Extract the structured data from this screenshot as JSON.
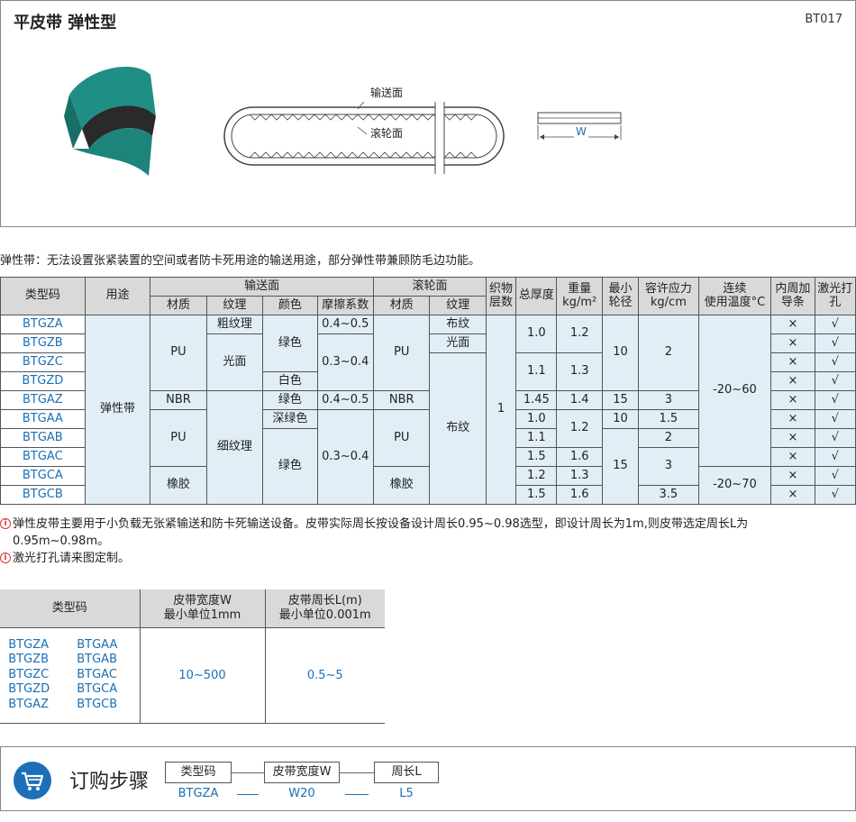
{
  "header": {
    "title": "平皮带   弹性型",
    "code": "BT017"
  },
  "diagram": {
    "label_conveying": "输送面",
    "label_roller": "滚轮面",
    "label_width": "W"
  },
  "description": "弹性带：无法设置张紧装置的空间或者防卡死用途的输送用途，部分弹性带兼顾防毛边功能。",
  "spec_table": {
    "headers": {
      "type_code": "类型码",
      "usage": "用途",
      "conveying": "输送面",
      "roller": "滚轮面",
      "layers": "织物层数",
      "thickness": "总厚度",
      "weight": "重量",
      "weight_unit": "kg/m²",
      "min_pulley": "最小轮径",
      "stress": "容许应力",
      "stress_unit": "kg/cm",
      "temp": "连续",
      "temp2": "使用温度°C",
      "guide": "内周加导条",
      "laser": "激光打孔",
      "sub": {
        "material": "材质",
        "texture": "纹理",
        "color": "颜色",
        "friction": "摩擦系数",
        "material2": "材质",
        "texture2": "纹理"
      }
    },
    "usage": "弹性带",
    "layers": "1",
    "codes": [
      "BTGZA",
      "BTGZB",
      "BTGZC",
      "BTGZD",
      "BTGAZ",
      "BTGAA",
      "BTGAB",
      "BTGAC",
      "BTGCA",
      "BTGCB"
    ],
    "cells": {
      "mat_pu1": "PU",
      "mat_nbr": "NBR",
      "mat_pu2": "PU",
      "mat_rubber": "橡胶",
      "tex_coarse": "粗纹理",
      "tex_smooth": "光面",
      "tex_fine": "细纹理",
      "col_green1": "绿色",
      "col_white": "白色",
      "col_green2": "绿色",
      "col_dgreen": "深绿色",
      "col_green3": "绿色",
      "fr_1": "0.4~0.5",
      "fr_2": "0.3~0.4",
      "fr_3": "0.4~0.5",
      "fr_4": "0.3~0.4",
      "rmat_pu1": "PU",
      "rmat_nbr": "NBR",
      "rmat_pu2": "PU",
      "rmat_rubber": "橡胶",
      "rtex_cloth1": "布纹",
      "rtex_smooth": "光面",
      "rtex_cloth2": "布纹",
      "th_1": "1.0",
      "th_2": "1.1",
      "th_3": "1.45",
      "th_4": "1.0",
      "th_5": "1.1",
      "th_6": "1.5",
      "th_7": "1.2",
      "th_8": "1.5",
      "wt_1": "1.2",
      "wt_2": "1.3",
      "wt_3": "1.4",
      "wt_4": "1.2",
      "wt_5": "1.6",
      "wt_6": "1.3",
      "wt_7": "1.6",
      "mp_1": "10",
      "mp_2": "15",
      "mp_3": "10",
      "mp_4": "15",
      "st_1": "2",
      "st_2": "3",
      "st_3": "1.5",
      "st_4": "2",
      "st_5": "3",
      "st_6": "3.5",
      "temp_1": "-20~60",
      "temp_2": "-20~70",
      "cross": "×",
      "check": "√"
    }
  },
  "notes": {
    "line1": "弹性皮带主要用于小负载无张紧输送和防卡死输送设备。皮带实际周长按设备设计周长0.95~0.98选型，即设计周长为1m,则皮带选定周长L为",
    "line1b": "0.95m~0.98m。",
    "line2": "激光打孔请来图定制。"
  },
  "selection_table": {
    "h_code": "类型码",
    "h_width": "皮带宽度W",
    "h_width_sub": "最小单位1mm",
    "h_length": "皮带周长L(m)",
    "h_length_sub": "最小单位0.001m",
    "codes_left": [
      "BTGZA",
      "BTGZB",
      "BTGZC",
      "BTGZD",
      "BTGAZ"
    ],
    "codes_right": [
      "BTGAA",
      "BTGAB",
      "BTGAC",
      "BTGCA",
      "BTGCB"
    ],
    "width_range": "10~500",
    "length_range": "0.5~5"
  },
  "order": {
    "title": "订购步骤",
    "step1_label": "类型码",
    "step2_label": "皮带宽度W",
    "step3_label": "周长L",
    "step1_value": "BTGZA",
    "step2_value": "W20",
    "step3_value": "L5",
    "icon": "shopping-cart-icon",
    "accent": "#1e6fb8"
  }
}
